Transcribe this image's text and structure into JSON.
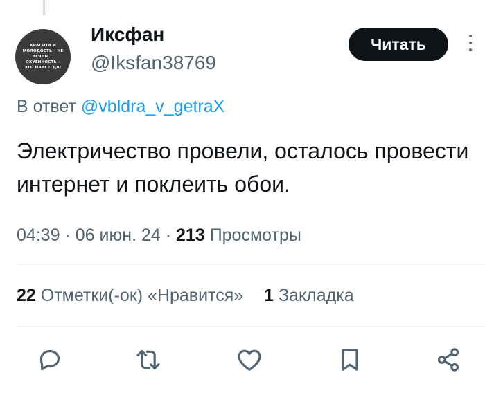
{
  "avatar": {
    "text": "КРАСОТА И МОЛОДОСТЬ – НЕ ВЕЧНЫ... ОХУЕННОСТЬ – ЭТО НАВСЕГДА!"
  },
  "user": {
    "name": "Иксфан",
    "handle": "@Iksfan38769"
  },
  "follow_button": {
    "label": "Читать"
  },
  "reply": {
    "prefix": "В ответ",
    "mention": "@vbldra_v_getraX"
  },
  "tweet": {
    "text": "Электричество провели, осталось провести интернет и поклеить обои."
  },
  "meta": {
    "time": "04:39",
    "sep1": "·",
    "date": "06 июн. 24",
    "sep2": "·",
    "views_count": "213",
    "views_label": "Просмотры"
  },
  "stats": {
    "likes_count": "22",
    "likes_label": "Отметки(-ок) «Нравится»",
    "bookmarks_count": "1",
    "bookmarks_label": "Закладка"
  },
  "actions": {
    "icons": [
      "reply-icon",
      "retweet-icon",
      "like-icon",
      "bookmark-icon",
      "share-icon"
    ]
  },
  "colors": {
    "text": "#0f1419",
    "secondary": "#536471",
    "link": "#1d9bf0",
    "divider": "#eff3f4",
    "button_bg": "#0f1419"
  }
}
